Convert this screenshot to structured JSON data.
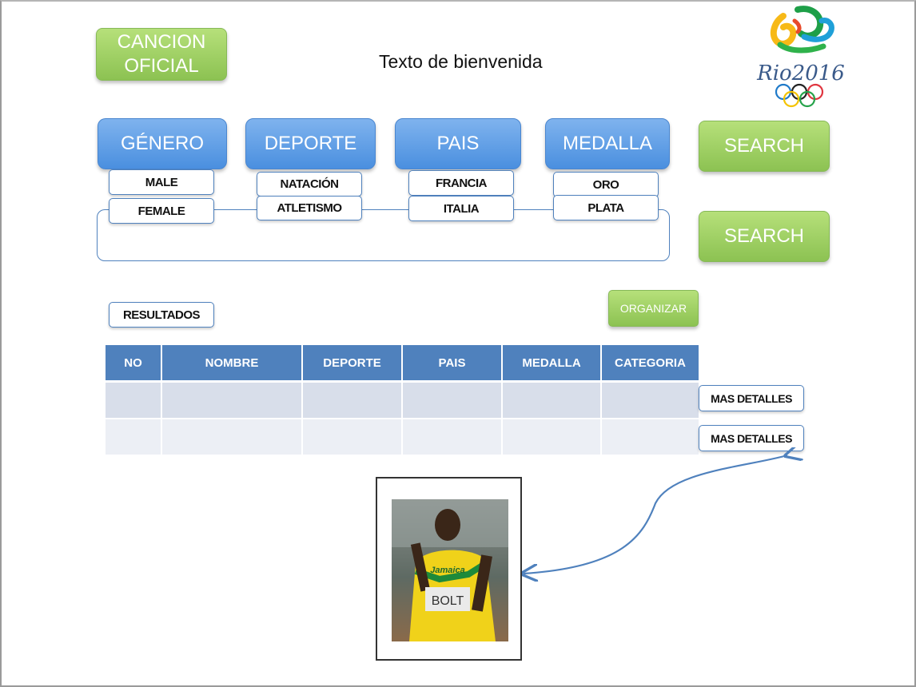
{
  "header": {
    "song_button": "CANCION OFICIAL",
    "welcome_text": "Texto de bienvenida",
    "logo_text": "Rio2016"
  },
  "filters": [
    {
      "label": "GÉNERO",
      "options": [
        "MALE",
        "FEMALE"
      ]
    },
    {
      "label": "DEPORTE",
      "options": [
        "NATACIÓN",
        "ATLETISMO"
      ]
    },
    {
      "label": "PAIS",
      "options": [
        "FRANCIA",
        "ITALIA"
      ]
    },
    {
      "label": "MEDALLA",
      "options": [
        "ORO",
        "PLATA"
      ]
    }
  ],
  "search_buttons": [
    "SEARCH",
    "SEARCH"
  ],
  "results": {
    "label": "RESULTADOS",
    "organize_button": "ORGANIZAR",
    "columns": [
      "NO",
      "NOMBRE",
      "DEPORTE",
      "PAIS",
      "MEDALLA",
      "CATEGORIA"
    ],
    "detail_buttons": [
      "MAS DETALLES",
      "MAS DETALLES"
    ]
  },
  "photo": {
    "bib_text": "BOLT",
    "shirt_text": "Jamaica"
  },
  "colors": {
    "accent_blue": "#4f81bd",
    "button_green": "#9bcf5e",
    "header_blue": "#4f81bd"
  }
}
